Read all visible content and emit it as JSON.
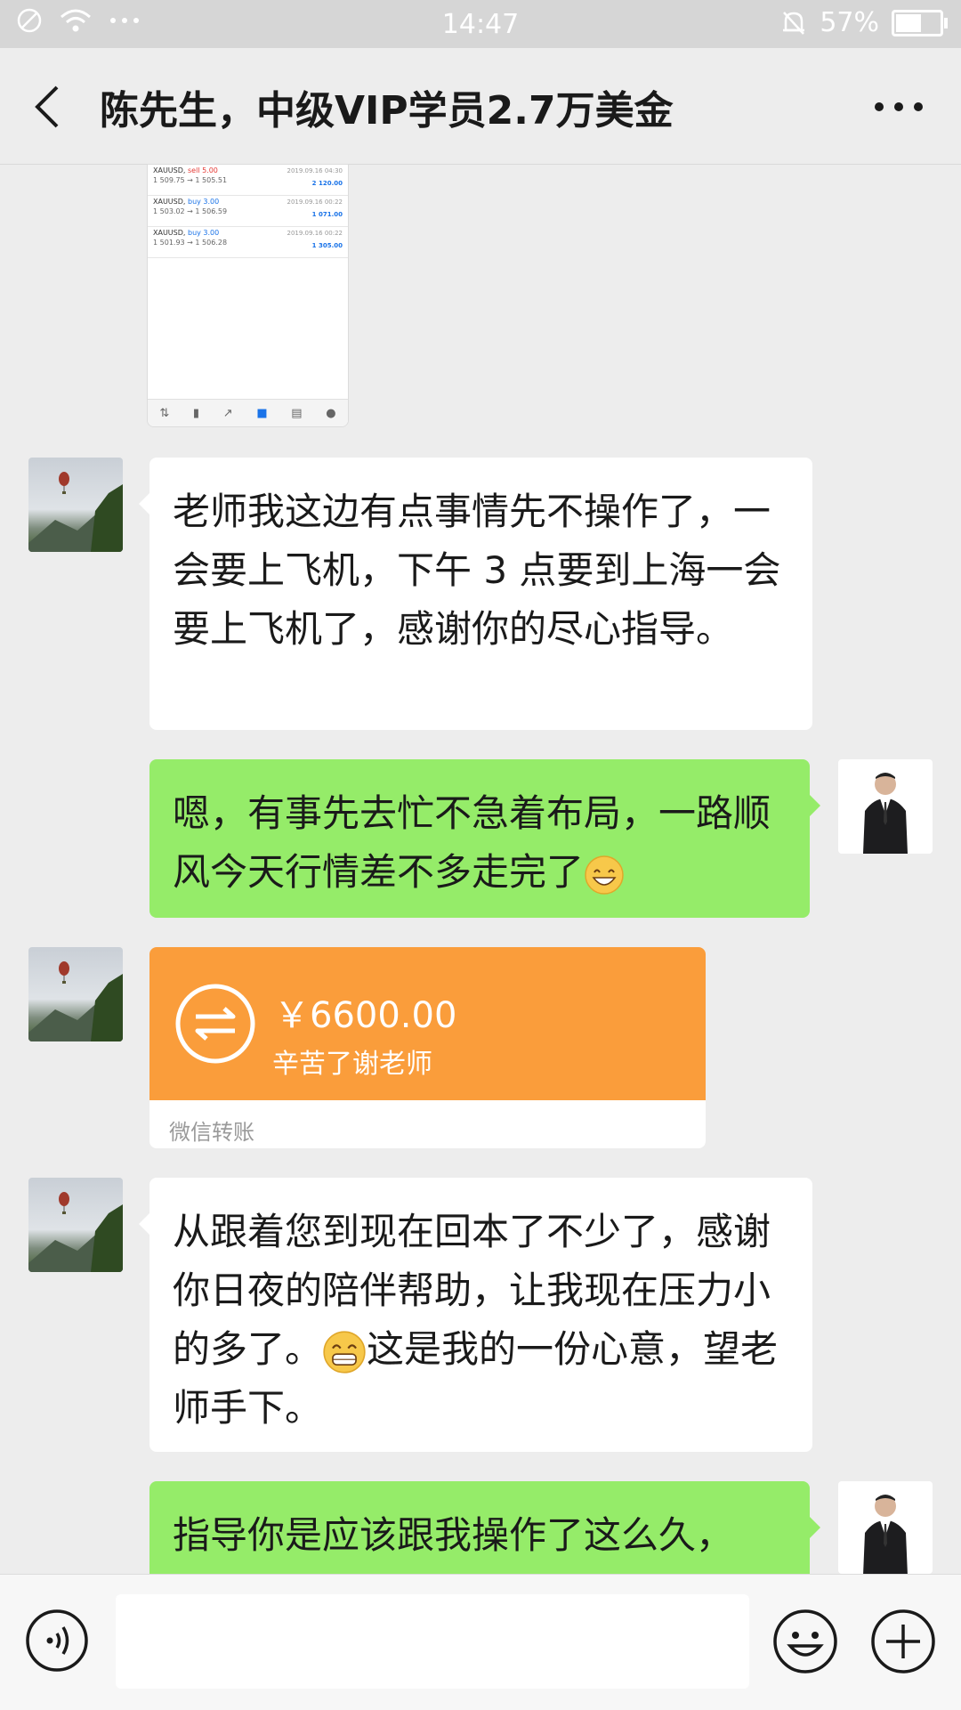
{
  "status_bar": {
    "time": "14:47",
    "battery": "57%"
  },
  "header": {
    "title": "陈先生，中级VIP学员2.7万美金"
  },
  "screenshot": {
    "trades": [
      {
        "symbol": "XAUUSD,",
        "side": "sell 5.00",
        "date": "2019.09.16 04:30",
        "prices": "1 509.75 → 1 505.51",
        "profit": "2 120.00"
      },
      {
        "symbol": "XAUUSD,",
        "side": "buy 3.00",
        "date": "2019.09.16 00:22",
        "prices": "1 503.02 → 1 506.59",
        "profit": "1 071.00"
      },
      {
        "symbol": "XAUUSD,",
        "side": "buy 3.00",
        "date": "2019.09.16 00:22",
        "prices": "1 501.93 → 1 506.28",
        "profit": "1 305.00"
      }
    ]
  },
  "messages": {
    "m1": "老师我这边有点事情先不操作了，一会要上飞机，下午 3 点要到上海一会要上飞机了，感谢你的尽心指导。",
    "m2": "嗯，有事先去忙不急着布局，一路顺风今天行情差不多走完了",
    "m4a": "从跟着您到现在回本了不少了，感谢你日夜的陪伴帮助，让我现在压力小的多了。",
    "m4b": "这是我的一份心意，望老师手下。",
    "m5": "指导你是应该跟我操作了这么久，"
  },
  "transfer": {
    "amount": "￥6600.00",
    "note": "辛苦了谢老师",
    "footer": "微信转账"
  },
  "input": {
    "placeholder": ""
  }
}
